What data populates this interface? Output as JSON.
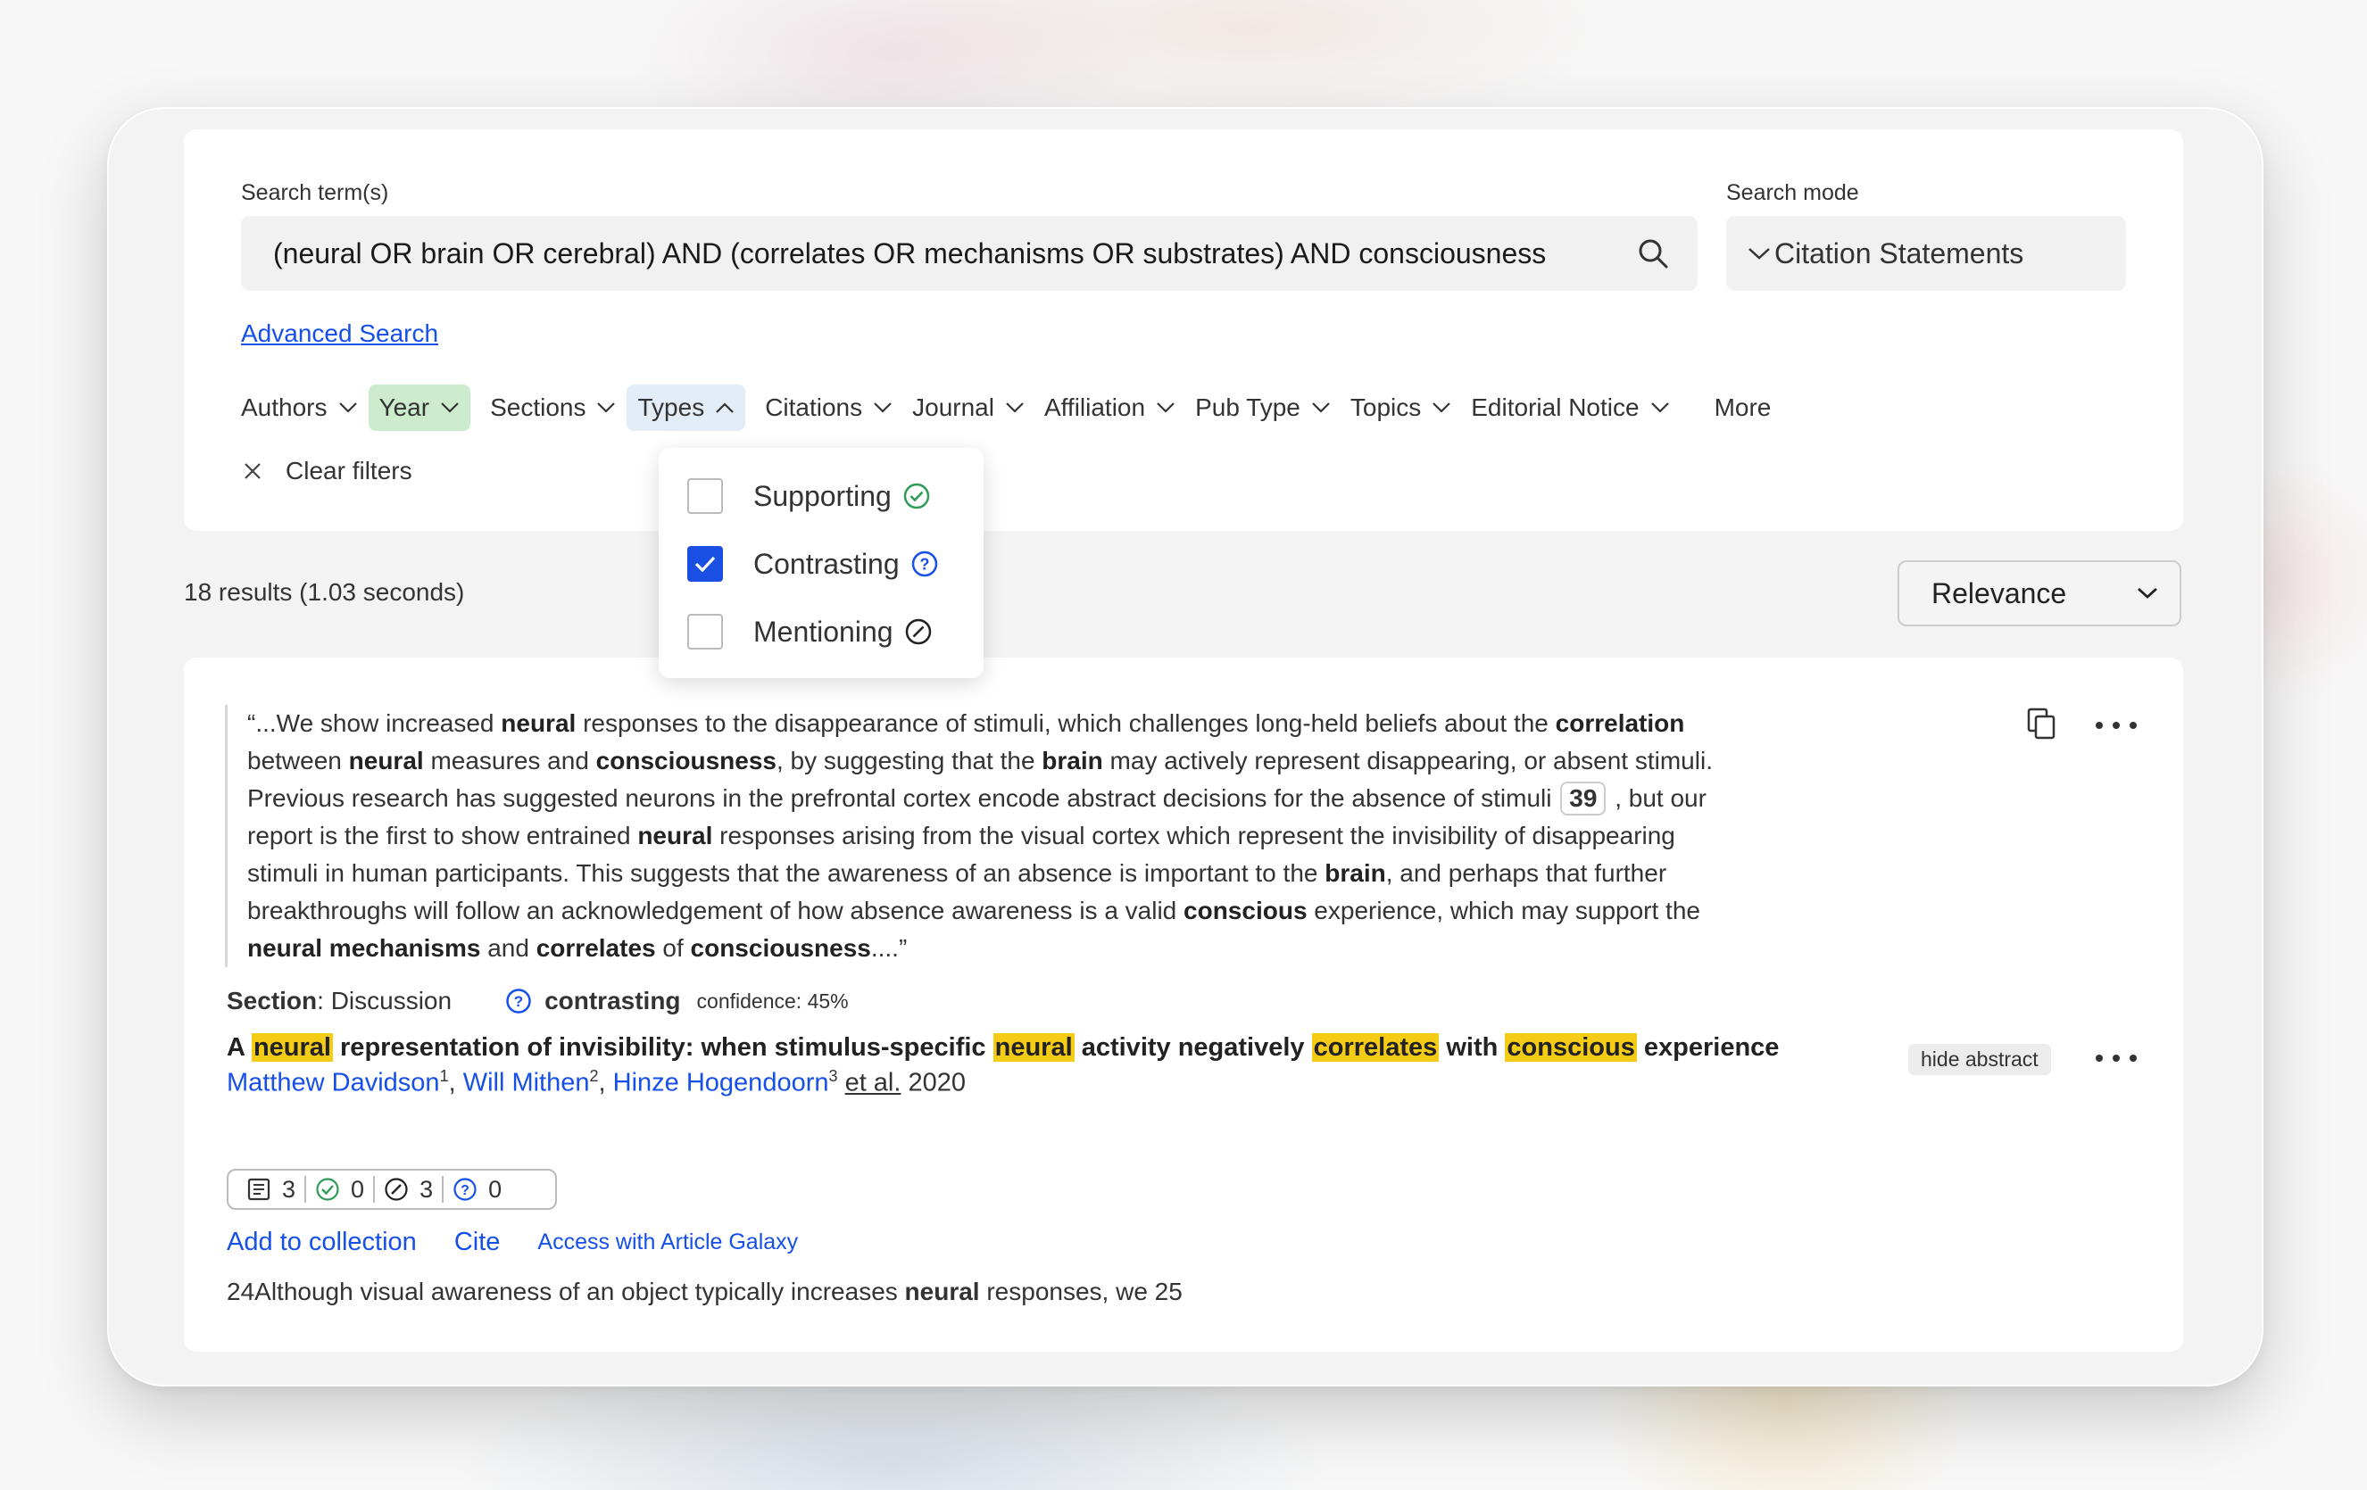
{
  "search": {
    "terms_label": "Search term(s)",
    "query": "(neural OR brain OR cerebral) AND (correlates OR mechanisms OR substrates) AND consciousness",
    "mode_label": "Search mode",
    "mode_value": "Citation Statements",
    "advanced_link": "Advanced Search"
  },
  "filters": {
    "items": [
      "Authors",
      "Year",
      "Sections",
      "Types",
      "Citations",
      "Journal",
      "Affiliation",
      "Pub Type",
      "Topics",
      "Editorial Notice",
      "More"
    ],
    "active": "Year",
    "open": "Types",
    "clear_label": "Clear filters"
  },
  "types_dropdown": {
    "options": [
      {
        "label": "Supporting",
        "checked": false,
        "icon": "check-circle-icon",
        "color": "#2e9c56"
      },
      {
        "label": "Contrasting",
        "checked": true,
        "icon": "question-circle-icon",
        "color": "#1650e8"
      },
      {
        "label": "Mentioning",
        "checked": false,
        "icon": "slash-circle-icon",
        "color": "#222222"
      }
    ]
  },
  "results": {
    "count_text": "18 results (1.03 seconds)",
    "sort_value": "Relevance"
  },
  "result": {
    "quote": {
      "l1a": "“...We show increased ",
      "l1b": "neural",
      "l1c": " responses to the disappearance of stimuli, which challenges long-held beliefs about the ",
      "l1d": "correlation",
      "l2a": "between ",
      "l2b": "neural",
      "l2c": " measures and ",
      "l2d": "consciousness",
      "l2e": ", by suggesting that the ",
      "l2f": "brain",
      "l2g": " may actively represent disappearing, or absent stimuli.",
      "l3a": "Previous research has suggested neurons in the prefrontal cortex encode abstract decisions for the absence of stimuli ",
      "l3b": "39",
      "l3c": " , but our",
      "l4a": "report is the first to show entrained ",
      "l4b": "neural",
      "l4c": " responses arising from the visual cortex which represent the invisibility of disappearing",
      "l5a": "stimuli in human participants. This suggests that the awareness of an absence is important to the ",
      "l5b": "brain",
      "l5c": ", and perhaps that further",
      "l6a": "breakthroughs will follow an acknowledgement of how absence awareness is a valid ",
      "l6b": "conscious",
      "l6c": " experience, which may support the",
      "l7a": "neural mechanisms",
      "l7b": " and ",
      "l7c": "correlates",
      "l7d": " of ",
      "l7e": "consciousness",
      "l7f": "....”"
    },
    "section_label": "Section",
    "section_value": ": Discussion",
    "classification": "contrasting",
    "confidence": "confidence: 45%",
    "title": {
      "t1": "A ",
      "t2": "neural",
      "t3": " representation of invisibility: when stimulus-specific ",
      "t4": "neural",
      "t5": " activity negatively ",
      "t6": "correlates",
      "t7": " with ",
      "t8": "conscious",
      "t9": " experience"
    },
    "authors": [
      {
        "name": "Matthew Davidson",
        "sup": "1"
      },
      {
        "name": "Will Mithen",
        "sup": "2"
      },
      {
        "name": "Hinze Hogendoorn",
        "sup": "3"
      }
    ],
    "et_al": "et al.",
    "year": "2020",
    "hide_abstract": "hide abstract",
    "tally": {
      "publications": "3",
      "supporting": "0",
      "mentioning": "3",
      "contrasting": "0"
    },
    "actions": {
      "add": "Add to collection",
      "cite": "Cite",
      "access": "Access with Article Galaxy"
    },
    "snippet": {
      "a": "24Although visual awareness of an object typically increases ",
      "b": "neural",
      "c": " responses, we 25"
    }
  }
}
